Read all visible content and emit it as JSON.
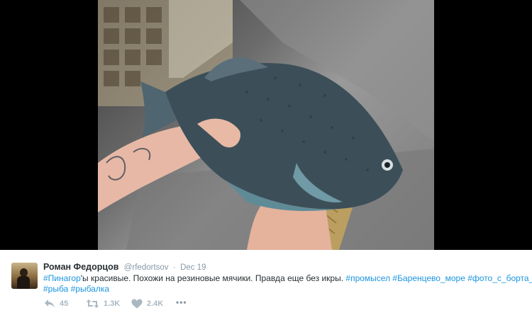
{
  "tweet": {
    "author_name": "Роман Федорцов",
    "author_handle": "@rfedortsov",
    "separator": "·",
    "date": "Dec 19",
    "text_parts": {
      "hashtag_pinagor": "#Пинагор",
      "text_1": "'ы красивые. Похожи на резиновые мячики. Правда еще без икры. ",
      "hashtag_promysel": "#промысел",
      "hashtag_barents": "#Баренцево_море",
      "hashtag_photo": "#фото_с_борта_судна",
      "hashtag_ryba": "#рыба",
      "hashtag_rybalka": "#рыбалка"
    },
    "actions": {
      "reply_count": "45",
      "retweet_count": "1.3K",
      "like_count": "2.4K",
      "more_label": "•••"
    }
  },
  "icons": {
    "reply": "reply-icon",
    "retweet": "retweet-icon",
    "like": "heart-icon",
    "more": "more-icon"
  },
  "colors": {
    "hashtag": "#1b95e0",
    "name": "#292f33",
    "muted": "#8899a6",
    "action_icon": "#aab8c2",
    "media_background": "#000000"
  }
}
